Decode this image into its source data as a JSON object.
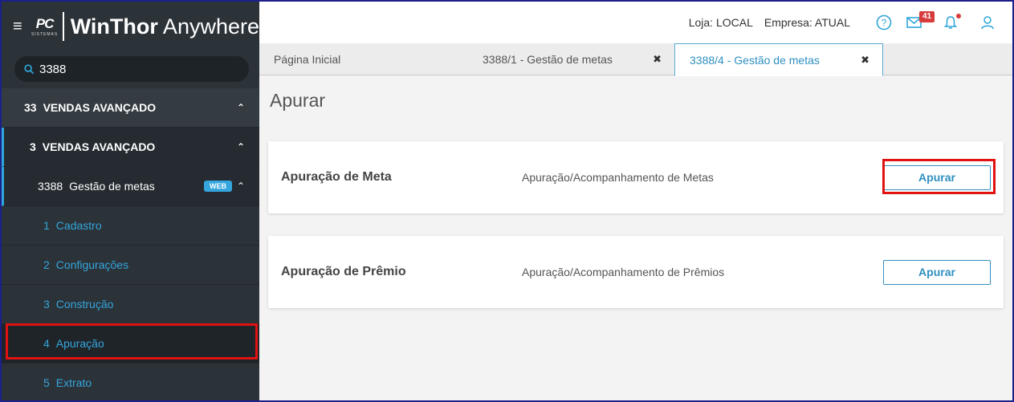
{
  "app": {
    "brand_bold": "WinThor",
    "brand_light": " Anywhere",
    "logo_text": "PC",
    "logo_sub": "SISTEMAS"
  },
  "search": {
    "value": "3388"
  },
  "menu": {
    "items": [
      {
        "num": "33",
        "label": "VENDAS AVANÇADO"
      },
      {
        "num": "3",
        "label": "VENDAS AVANÇADO"
      },
      {
        "num": "3388",
        "label": "Gestão de metas",
        "badge": "WEB"
      },
      {
        "num": "1",
        "label": "Cadastro"
      },
      {
        "num": "2",
        "label": "Configurações"
      },
      {
        "num": "3",
        "label": "Construção"
      },
      {
        "num": "4",
        "label": "Apuração"
      },
      {
        "num": "5",
        "label": "Extrato"
      }
    ]
  },
  "topbar": {
    "loja": "Loja: LOCAL",
    "empresa": "Empresa: ATUAL",
    "mail_count": "41"
  },
  "tabs": [
    {
      "label": "Página Inicial"
    },
    {
      "label": "3388/1 - Gestão de metas",
      "close": "✖"
    },
    {
      "label": "3388/4 - Gestão de metas",
      "close": "✖"
    }
  ],
  "page": {
    "title": "Apurar",
    "cards": [
      {
        "title": "Apuração de Meta",
        "desc": "Apuração/Acompanhamento de Metas",
        "button": "Apurar"
      },
      {
        "title": "Apuração de Prêmio",
        "desc": "Apuração/Acompanhamento de Prêmios",
        "button": "Apurar"
      }
    ]
  },
  "colors": {
    "sidebar_bg": "#2b3238",
    "accent": "#2fa6d9",
    "highlight": "#e01212"
  }
}
